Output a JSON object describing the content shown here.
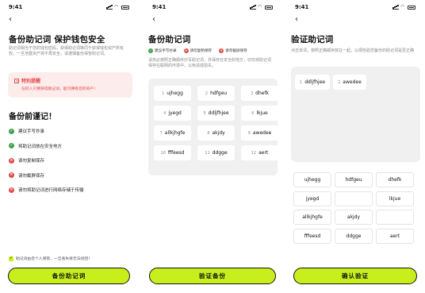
{
  "status": {
    "time": "9:41"
  },
  "screen1": {
    "title": "备份助记词 保护钱包安全",
    "desc": "助记词相当于您的钱包密码，获得助记词等同于获得钱包资产所有权。一旦泄露资产将不再安全，请谨慎备份保管助记词。",
    "warning": {
      "title": "特别提醒",
      "text": "任何人只要获得助记词，能可拥有您的资产！"
    },
    "subtitle": "备份前谨记！",
    "tips": [
      {
        "kind": "ok",
        "icon": "check-icon",
        "text": "建议手写抄录"
      },
      {
        "kind": "ok",
        "icon": "check-icon",
        "text": "将助记词放在安全地方"
      },
      {
        "kind": "no",
        "icon": "cross-icon",
        "text": "请勿复制保存"
      },
      {
        "kind": "no",
        "icon": "cross-icon",
        "text": "请勿截屏保存"
      },
      {
        "kind": "no",
        "icon": "cross-icon",
        "text": "请勿将助记词进行网络存储于传输"
      }
    ],
    "agree": "助记词由您个人保管，一旦丢失将无法找回！",
    "button": "备份助记词"
  },
  "screen2": {
    "title": "备份助记词",
    "tags": [
      {
        "kind": "ok",
        "text": "建议手写抄录"
      },
      {
        "kind": "no",
        "text": "请勿复制保存"
      },
      {
        "kind": "no",
        "text": "请勿截屏保存"
      }
    ],
    "desc": "请务必按照正确顺序抄写助记词，并保存在安全的地方，切勿将助记词保存在联网的环境中，以免造成损失。",
    "words": [
      {
        "n": "1",
        "w": "ujhegg"
      },
      {
        "n": "2",
        "w": "hdfgeu"
      },
      {
        "n": "3",
        "w": "dhefk"
      },
      {
        "n": "4",
        "w": "jyegd"
      },
      {
        "n": "5",
        "w": "ddljfhjee"
      },
      {
        "n": "6",
        "w": "lkjue"
      },
      {
        "n": "7",
        "w": "allkjhgfe"
      },
      {
        "n": "8",
        "w": "akjdy"
      },
      {
        "n": "9",
        "w": "awedee"
      },
      {
        "n": "10",
        "w": "fffeesd"
      },
      {
        "n": "11",
        "w": "ddgge"
      },
      {
        "n": "12",
        "w": "aert"
      }
    ],
    "button": "验证备份"
  },
  "screen3": {
    "title": "验证助记词",
    "desc": "点击单词，按照正确顺序放在一起，以便检验您备份的助记词是否正确",
    "selected": [
      {
        "n": "1",
        "w": "ddljfhjee"
      },
      {
        "n": "2",
        "w": "awedee"
      }
    ],
    "choices": [
      "ujhegg",
      "hdfgeu",
      "dhefk",
      "jyegd",
      "",
      "lkjue",
      "allkjhgfe",
      "akjdy",
      "",
      "fffeesd",
      "ddgge",
      "aert"
    ],
    "button": "确认验证"
  }
}
